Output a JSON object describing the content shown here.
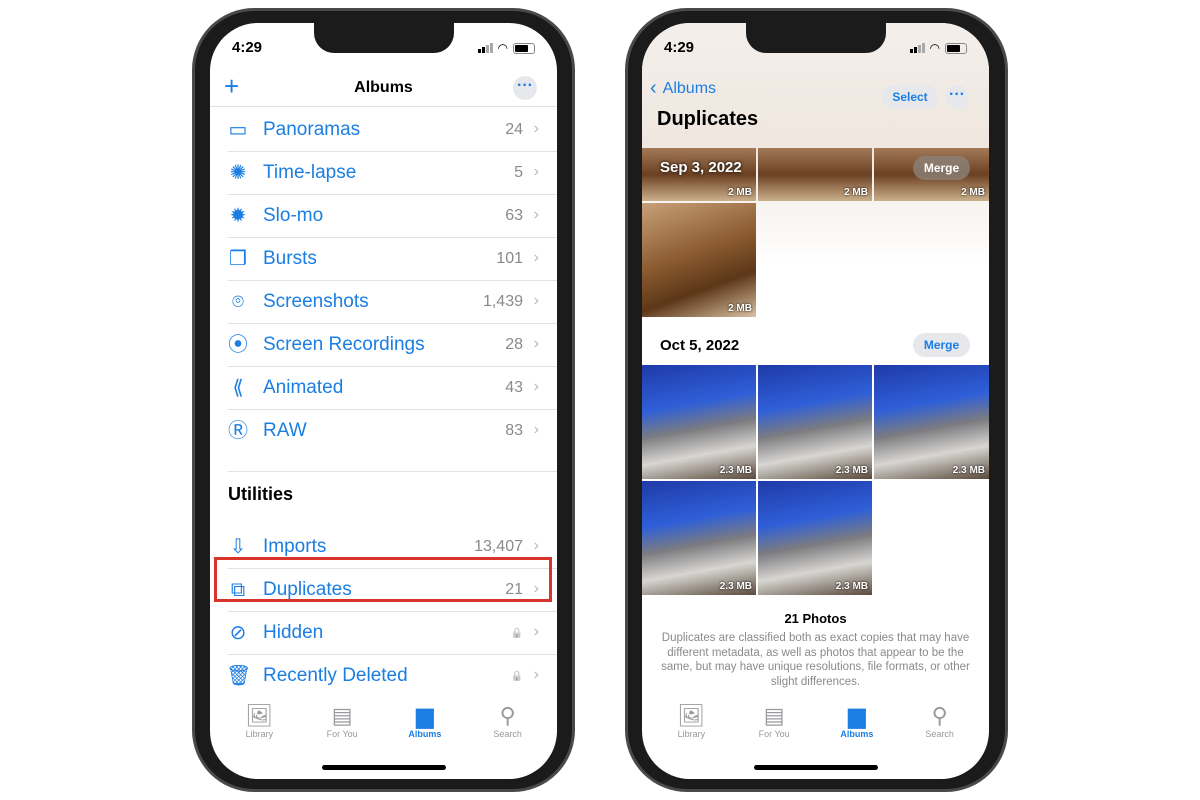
{
  "status": {
    "time": "4:29"
  },
  "left": {
    "nav": {
      "title": "Albums",
      "add_icon": "plus-icon",
      "more_icon": "ellipsis-icon"
    },
    "media_types": [
      {
        "label": "Panoramas",
        "count": "24",
        "icon": "panorama-icon",
        "glyph": "▭"
      },
      {
        "label": "Time-lapse",
        "count": "5",
        "icon": "timelapse-icon",
        "glyph": "✺"
      },
      {
        "label": "Slo-mo",
        "count": "63",
        "icon": "slomo-icon",
        "glyph": "✹"
      },
      {
        "label": "Bursts",
        "count": "101",
        "icon": "bursts-icon",
        "glyph": "❒"
      },
      {
        "label": "Screenshots",
        "count": "1,439",
        "icon": "screenshot-icon",
        "glyph": "⌾"
      },
      {
        "label": "Screen Recordings",
        "count": "28",
        "icon": "screen-recording-icon",
        "glyph": "⦿"
      },
      {
        "label": "Animated",
        "count": "43",
        "icon": "animated-icon",
        "glyph": "⟪"
      },
      {
        "label": "RAW",
        "count": "83",
        "icon": "raw-icon",
        "glyph": "Ⓡ"
      }
    ],
    "utilities_header": "Utilities",
    "utilities": [
      {
        "label": "Imports",
        "count": "13,407",
        "icon": "import-icon",
        "glyph": "⇩"
      },
      {
        "label": "Duplicates",
        "count": "21",
        "icon": "duplicates-icon",
        "glyph": "⧉",
        "highlighted": true
      },
      {
        "label": "Hidden",
        "count": "🔒",
        "icon": "eye-slash-icon",
        "glyph": "⊘"
      },
      {
        "label": "Recently Deleted",
        "count": "🔒",
        "icon": "trash-icon",
        "glyph": "🗑"
      }
    ],
    "highlight_color": "#d9342b"
  },
  "right": {
    "nav": {
      "back_label": "Albums",
      "select_label": "Select",
      "title": "Duplicates"
    },
    "groups": [
      {
        "date": "Sep 3, 2022",
        "merge_label": "Merge",
        "sizes": [
          "2 MB",
          "2 MB",
          "2 MB",
          "2 MB"
        ]
      },
      {
        "date": "Oct 5, 2022",
        "merge_label": "Merge",
        "sizes": [
          "2.3 MB",
          "2.3 MB",
          "2.3 MB",
          "2.3 MB",
          "2.3 MB"
        ]
      }
    ],
    "footer": {
      "count": "21 Photos",
      "description": "Duplicates are classified both as exact copies that may have different metadata, as well as photos that appear to be the same, but may have unique resolutions, file formats, or other slight differences."
    }
  },
  "tabs": [
    {
      "label": "Library",
      "icon": "library-icon",
      "glyph": "🖼"
    },
    {
      "label": "For You",
      "icon": "for-you-icon",
      "glyph": "▤"
    },
    {
      "label": "Albums",
      "icon": "albums-icon",
      "glyph": "▆",
      "active": true
    },
    {
      "label": "Search",
      "icon": "search-icon",
      "glyph": "⚲"
    }
  ],
  "accent": "#1a7ee3"
}
